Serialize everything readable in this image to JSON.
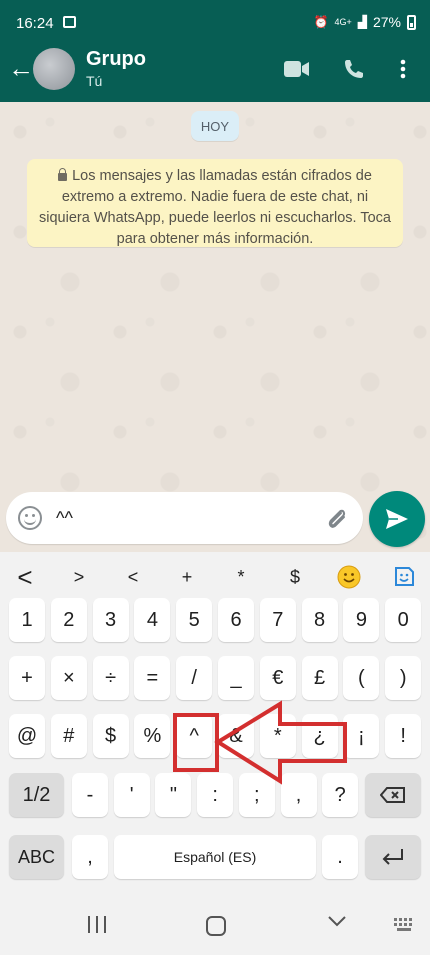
{
  "status_bar": {
    "time": "16:24",
    "network": "4G+",
    "battery": "27%"
  },
  "header": {
    "title": "Grupo",
    "subtitle": "Tú"
  },
  "chat": {
    "date_chip": "HOY",
    "notice": "Los mensajes y las llamadas están cifrados de extremo a extremo. Nadie fuera de este chat, ni siquiera WhatsApp, puede leerlos ni escucharlos. Toca para obtener más información."
  },
  "composer": {
    "value": "^^"
  },
  "keyboard": {
    "toolbar": [
      "<",
      ">",
      "<",
      "+",
      "*",
      "$"
    ],
    "row1": [
      "1",
      "2",
      "3",
      "4",
      "5",
      "6",
      "7",
      "8",
      "9",
      "0"
    ],
    "row2": [
      "+",
      "×",
      "÷",
      "=",
      "/",
      "_",
      "€",
      "£",
      "(",
      ")"
    ],
    "row3": [
      "@",
      "#",
      "$",
      "%",
      "^",
      "&",
      "*",
      "¿",
      "¡",
      "!"
    ],
    "row4": [
      "1/2",
      "-",
      "'",
      "\"",
      ":",
      ";",
      ",",
      "?"
    ],
    "row5": [
      "ABC",
      ",",
      "Español (ES)",
      "."
    ]
  },
  "colors": {
    "header": "#075e54",
    "send": "#00897b",
    "highlight": "#d32f2f"
  }
}
